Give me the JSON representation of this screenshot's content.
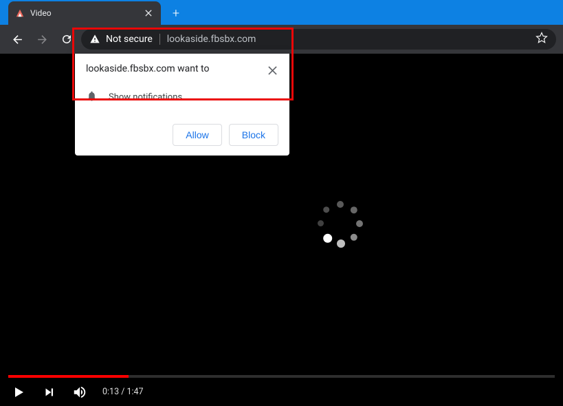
{
  "tab": {
    "title": "Video"
  },
  "address": {
    "security_label": "Not secure",
    "url": "lookaside.fbsbx.com"
  },
  "permission": {
    "prompt": "lookaside.fbsbx.com want to",
    "item": "Show notifications",
    "allow": "Allow",
    "block": "Block"
  },
  "video": {
    "current_time": "0:13",
    "duration": "1:47",
    "progress_percent": 22
  }
}
